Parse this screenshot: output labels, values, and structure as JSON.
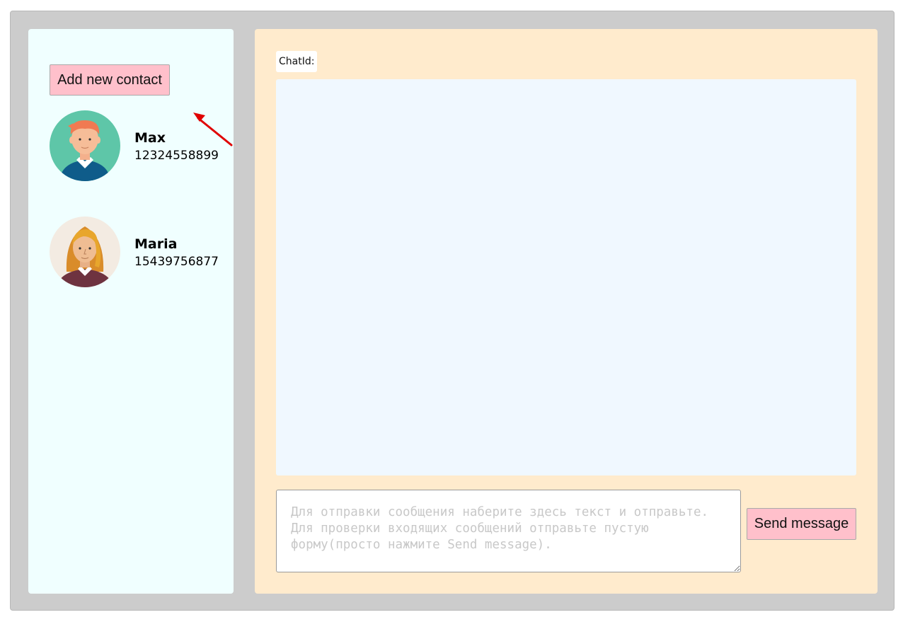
{
  "sidebar": {
    "add_contact_label": "Add new contact",
    "contacts": [
      {
        "name": "Max",
        "phone": "12324558899",
        "avatar": "male-avatar-icon"
      },
      {
        "name": "Maria",
        "phone": "15439756877",
        "avatar": "female-avatar-icon"
      }
    ]
  },
  "chat": {
    "chat_id_label": "ChatId:",
    "input_placeholder": "Для отправки сообщения наберите здесь текст и отправьте. Для проверки входящих сообщений отправьте пустую форму(просто нажмите Send message).",
    "send_label": "Send message"
  },
  "colors": {
    "frame_bg": "#cccccc",
    "sidebar_bg": "#f0ffff",
    "chat_panel_bg": "#ffebcd",
    "chat_log_bg": "#f0f8ff",
    "button_bg": "#ffc0cb",
    "annotation_arrow": "#e00000"
  }
}
